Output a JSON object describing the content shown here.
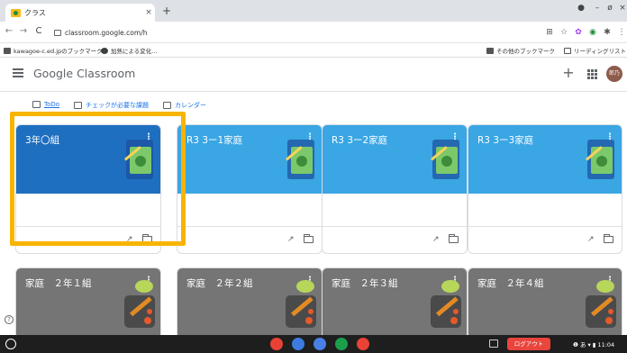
{
  "browser": {
    "tab_title": "クラス",
    "tab_close": "×",
    "new_tab": "+",
    "minimize": "–",
    "restore": "ø",
    "close": "×",
    "url": "classroom.google.com/h",
    "back": "←",
    "forward": "→",
    "reload": "C",
    "toolbar_icons": [
      "translate-icon",
      "star-icon",
      "extension-icon",
      "extension-icon",
      "puzzle-icon",
      "menu-icon"
    ]
  },
  "bookmarks": {
    "items": [
      "kawagoe-c.ed.jpのブックマーク",
      "加熱による変化..."
    ],
    "other": "その他のブックマーク",
    "reading_list": "リーディングリスト"
  },
  "classroom": {
    "logo_google": "Google",
    "logo_classroom": " Classroom",
    "plus": "+",
    "avatar_text": "郎乃",
    "subnav": [
      "ToDo",
      "チェックが必要な課題",
      "カレンダー"
    ]
  },
  "cards": [
    {
      "title": "3年〇組",
      "color": "#1e6fc0",
      "row": 0,
      "col": 0
    },
    {
      "title": "R3 3ー1家庭",
      "color": "#3aa6e4",
      "row": 0,
      "col": 1
    },
    {
      "title": "R3 3ー2家庭",
      "color": "#3aa6e4",
      "row": 0,
      "col": 2
    },
    {
      "title": "R3 3ー3家庭",
      "color": "#3aa6e4",
      "row": 0,
      "col": 3
    },
    {
      "title": "家庭　２年１組",
      "color": "#757575",
      "row": 1,
      "col": 0
    },
    {
      "title": "家庭　２年２組",
      "color": "#757575",
      "row": 1,
      "col": 1
    },
    {
      "title": "家庭　２年３組",
      "color": "#757575",
      "row": 1,
      "col": 2
    },
    {
      "title": "家庭　２年４組",
      "color": "#757575",
      "row": 1,
      "col": 3
    }
  ],
  "card_kebab": "⋮",
  "help": "?",
  "shelf": {
    "logout": "ログアウト",
    "clock": "❶ あ ▾ ▮ 11:04",
    "apps": [
      {
        "name": "chrome-icon",
        "color": "#e94235"
      },
      {
        "name": "drive-icon",
        "color": "#3c7be0"
      },
      {
        "name": "docs-icon",
        "color": "#4a7fe6"
      },
      {
        "name": "classroom-app-icon",
        "color": "#1b9e4b"
      },
      {
        "name": "gmail-icon",
        "color": "#e94235"
      }
    ]
  }
}
